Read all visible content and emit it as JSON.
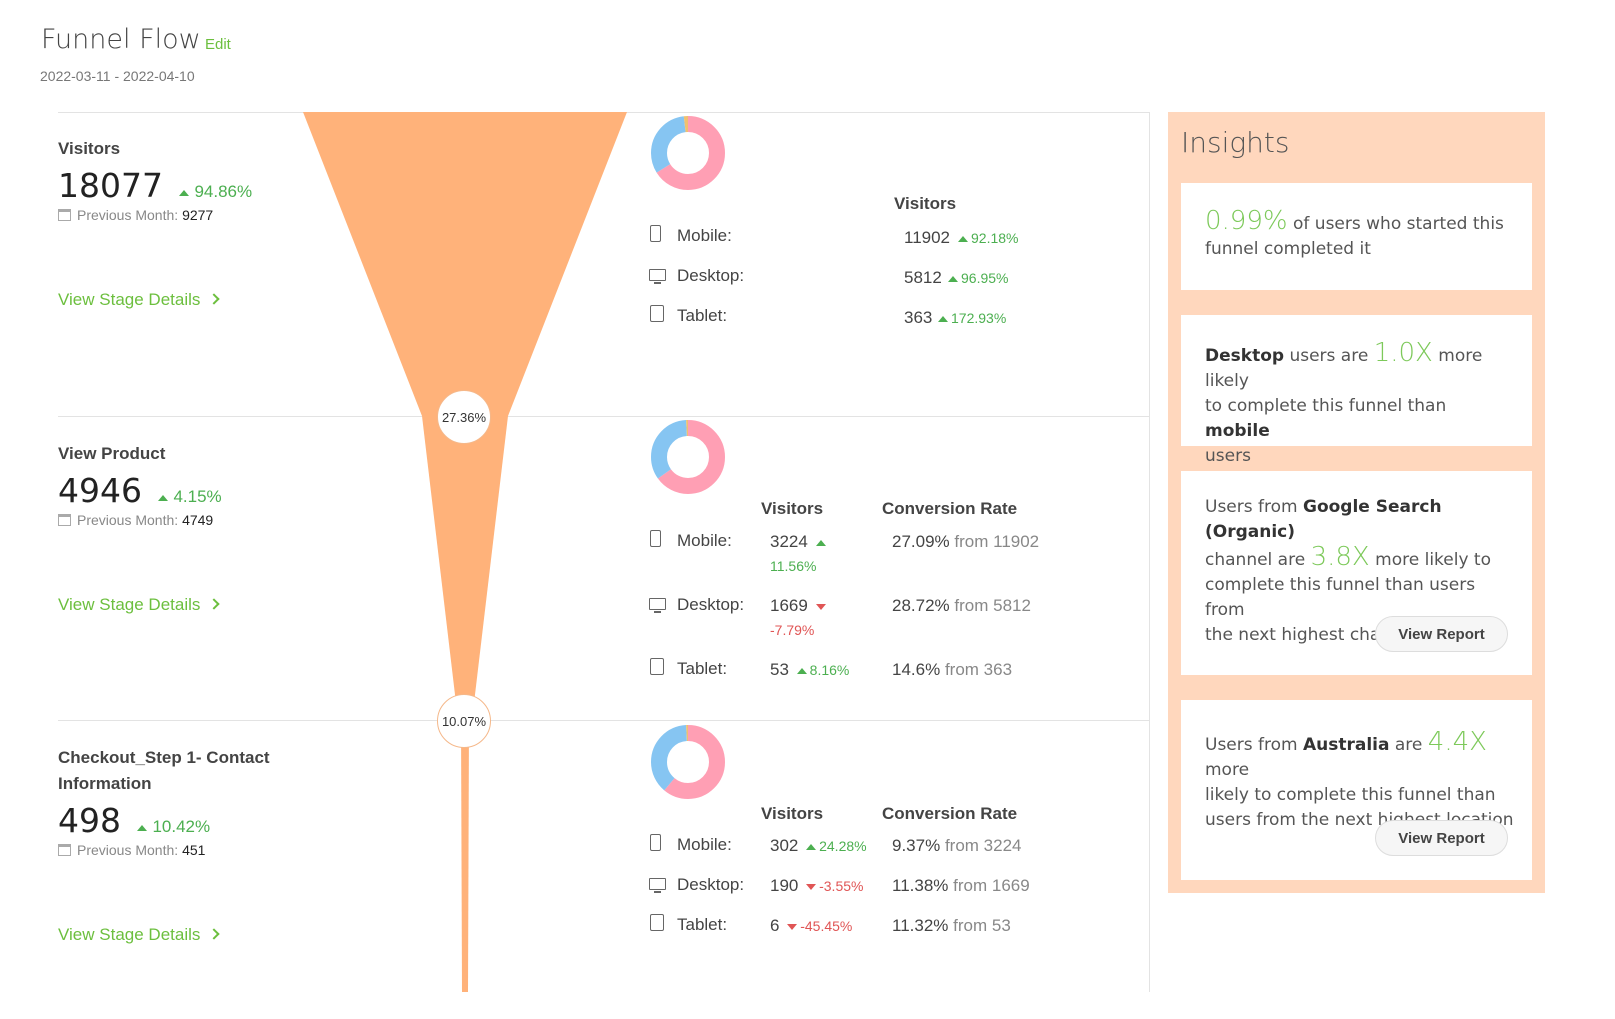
{
  "header": {
    "title": "Funnel Flow",
    "edit_label": "Edit",
    "date_range": "2022-03-11 - 2022-04-10"
  },
  "labels": {
    "previous_month": "Previous Month:",
    "view_stage_details": "View Stage Details",
    "visitors_col": "Visitors",
    "conversion_col": "Conversion Rate",
    "mobile": "Mobile:",
    "desktop": "Desktop:",
    "tablet": "Tablet:"
  },
  "stages": [
    {
      "name": "Visitors",
      "count": "18077",
      "change": "94.86%",
      "prev": "9277",
      "devices": {
        "mobile": {
          "value": "11902",
          "change": "92.18%"
        },
        "desktop": {
          "value": "5812",
          "change": "96.95%"
        },
        "tablet": {
          "value": "363",
          "change": "172.93%"
        }
      },
      "donut": {
        "mobile_fraction": 0.66,
        "desktop_fraction": 0.32,
        "tablet_fraction": 0.02
      }
    },
    {
      "name": "View Product",
      "count": "4946",
      "change": "4.15%",
      "prev": "4749",
      "devices": {
        "mobile": {
          "value": "3224",
          "change": "11.56%",
          "rate": "27.09%",
          "from": "from 11902"
        },
        "desktop": {
          "value": "1669",
          "change": "-7.79%",
          "rate": "28.72%",
          "from": "from 5812"
        },
        "tablet": {
          "value": "53",
          "change": "8.16%",
          "rate": "14.6%",
          "from": "from 363"
        }
      },
      "donut": {
        "mobile_fraction": 0.65,
        "desktop_fraction": 0.34,
        "tablet_fraction": 0.01
      }
    },
    {
      "name_line1": "Checkout_Step 1- Contact",
      "name_line2": "Information",
      "count": "498",
      "change": "10.42%",
      "prev": "451",
      "devices": {
        "mobile": {
          "value": "302",
          "change": "24.28%",
          "rate": "9.37%",
          "from": "from 3224"
        },
        "desktop": {
          "value": "190",
          "change": "-3.55%",
          "rate": "11.38%",
          "from": "from 1669"
        },
        "tablet": {
          "value": "6",
          "change": "-45.45%",
          "rate": "11.32%",
          "from": "from 53"
        }
      },
      "donut": {
        "mobile_fraction": 0.61,
        "desktop_fraction": 0.38,
        "tablet_fraction": 0.01
      }
    }
  ],
  "funnel": {
    "rate_1": "27.36%",
    "rate_2": "10.07%",
    "color": "#ffb27a"
  },
  "colors": {
    "donut_mobile": "#ff9fb4",
    "donut_desktop": "#86c5f2",
    "accent_green": "#6cbf3e",
    "insights_bg": "#ffd7bd"
  },
  "insights": {
    "title": "Insights",
    "card1": {
      "big": "0.99%",
      "text1": " of users who started this",
      "text2": "funnel completed it"
    },
    "card2": {
      "b1": "Desktop",
      "t1": " users are ",
      "big": "1.0X",
      "t2": " more likely",
      "t3": "to complete this funnel than ",
      "b2": "mobile",
      "t4": "users"
    },
    "card3": {
      "t1": "Users from ",
      "b1": "Google Search (Organic)",
      "t2": "channel are ",
      "big": "3.8X",
      "t3": " more likely to",
      "t4": "complete this funnel than users from",
      "t5": "the next highest channel",
      "button": "View Report"
    },
    "card4": {
      "t1": "Users from ",
      "b1": "Australia",
      "t2": " are ",
      "big": "4.4X",
      "t3": " more",
      "t4": "likely to complete this funnel than",
      "t5": "users from the next highest location",
      "button": "View Report"
    }
  }
}
